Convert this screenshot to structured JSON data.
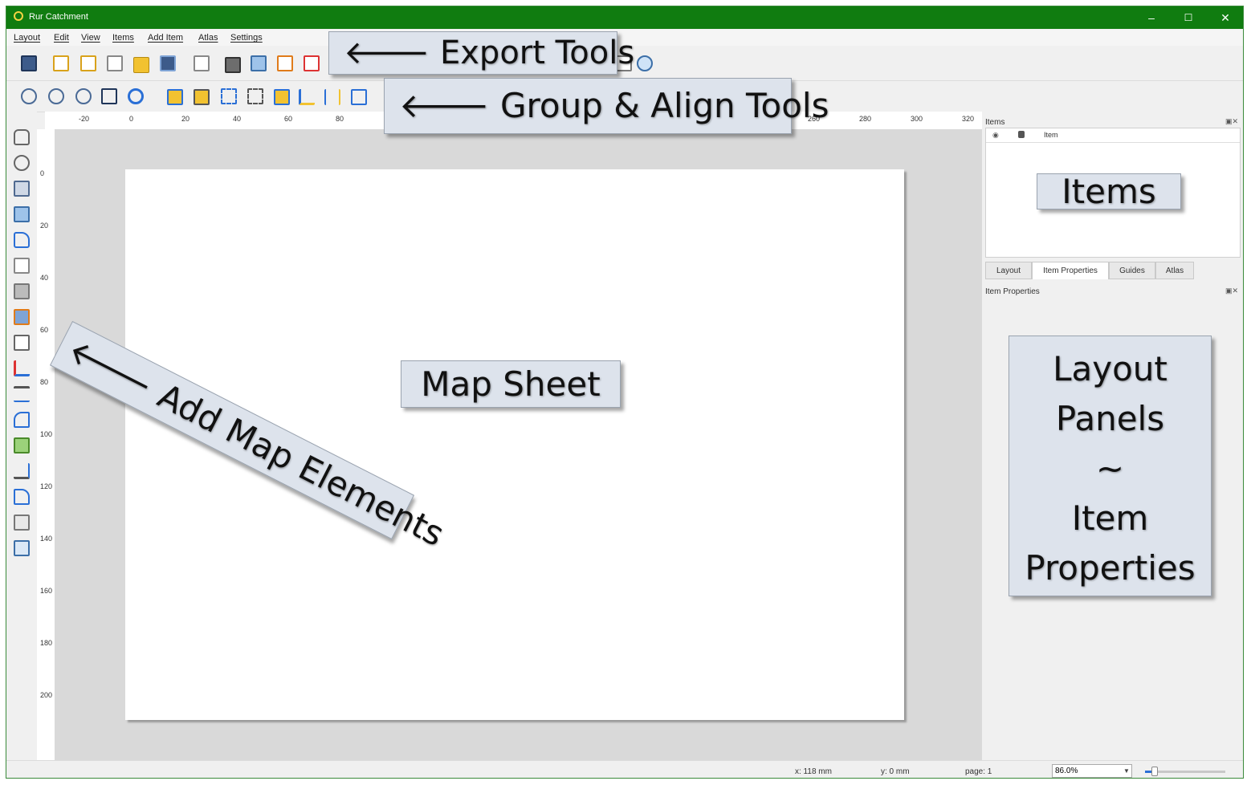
{
  "window": {
    "title": "Rur Catchment",
    "minimize": "–",
    "maximize": "☐",
    "close": "✕"
  },
  "menubar": [
    "Layout",
    "Edit",
    "View",
    "Items",
    "Add Item",
    "Atlas",
    "Settings"
  ],
  "ruler": {
    "horizontal": [
      "-20",
      "0",
      "20",
      "40",
      "60",
      "80",
      "260",
      "280",
      "300",
      "320"
    ],
    "vertical": [
      "0",
      "20",
      "40",
      "60",
      "80",
      "100",
      "120",
      "140",
      "160",
      "180",
      "200"
    ]
  },
  "panels": {
    "items_title": "Items",
    "column_item": "Item",
    "tabs": [
      "Layout",
      "Item Properties",
      "Guides",
      "Atlas"
    ],
    "item_properties_title": "Item Properties"
  },
  "status": {
    "x": "x: 118 mm",
    "y": "y: 0 mm",
    "page": "page: 1",
    "zoom": "86.0%",
    "zoom_slider_fraction": 0.12
  },
  "callouts": {
    "export_tools": "🡐 Export Tools",
    "group_align_tools": "🡐 Group & Align Tools",
    "add_map_elements": "🡐 Add Map Elements",
    "map_sheet": "Map Sheet",
    "items": "Items",
    "layout_panels_line1": "Layout",
    "layout_panels_line2": "Panels",
    "layout_panels_line3": "~",
    "layout_panels_line4": "Item",
    "layout_panels_line5": "Properties"
  },
  "colors": {
    "titlebar": "#107c10",
    "accent": "#2a6fd6"
  }
}
